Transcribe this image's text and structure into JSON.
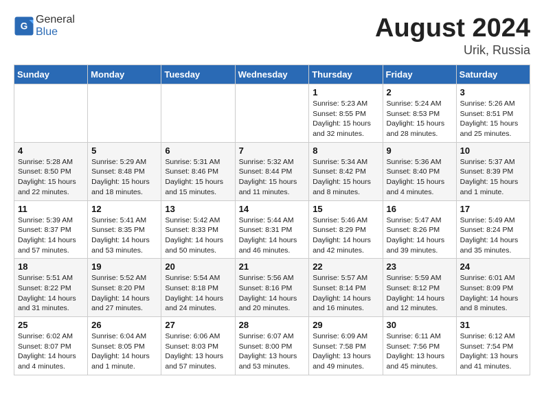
{
  "header": {
    "logo_general": "General",
    "logo_blue": "Blue",
    "month_year": "August 2024",
    "location": "Urik, Russia"
  },
  "weekdays": [
    "Sunday",
    "Monday",
    "Tuesday",
    "Wednesday",
    "Thursday",
    "Friday",
    "Saturday"
  ],
  "weeks": [
    [
      {
        "day": "",
        "details": ""
      },
      {
        "day": "",
        "details": ""
      },
      {
        "day": "",
        "details": ""
      },
      {
        "day": "",
        "details": ""
      },
      {
        "day": "1",
        "details": "Sunrise: 5:23 AM\nSunset: 8:55 PM\nDaylight: 15 hours\nand 32 minutes."
      },
      {
        "day": "2",
        "details": "Sunrise: 5:24 AM\nSunset: 8:53 PM\nDaylight: 15 hours\nand 28 minutes."
      },
      {
        "day": "3",
        "details": "Sunrise: 5:26 AM\nSunset: 8:51 PM\nDaylight: 15 hours\nand 25 minutes."
      }
    ],
    [
      {
        "day": "4",
        "details": "Sunrise: 5:28 AM\nSunset: 8:50 PM\nDaylight: 15 hours\nand 22 minutes."
      },
      {
        "day": "5",
        "details": "Sunrise: 5:29 AM\nSunset: 8:48 PM\nDaylight: 15 hours\nand 18 minutes."
      },
      {
        "day": "6",
        "details": "Sunrise: 5:31 AM\nSunset: 8:46 PM\nDaylight: 15 hours\nand 15 minutes."
      },
      {
        "day": "7",
        "details": "Sunrise: 5:32 AM\nSunset: 8:44 PM\nDaylight: 15 hours\nand 11 minutes."
      },
      {
        "day": "8",
        "details": "Sunrise: 5:34 AM\nSunset: 8:42 PM\nDaylight: 15 hours\nand 8 minutes."
      },
      {
        "day": "9",
        "details": "Sunrise: 5:36 AM\nSunset: 8:40 PM\nDaylight: 15 hours\nand 4 minutes."
      },
      {
        "day": "10",
        "details": "Sunrise: 5:37 AM\nSunset: 8:39 PM\nDaylight: 15 hours\nand 1 minute."
      }
    ],
    [
      {
        "day": "11",
        "details": "Sunrise: 5:39 AM\nSunset: 8:37 PM\nDaylight: 14 hours\nand 57 minutes."
      },
      {
        "day": "12",
        "details": "Sunrise: 5:41 AM\nSunset: 8:35 PM\nDaylight: 14 hours\nand 53 minutes."
      },
      {
        "day": "13",
        "details": "Sunrise: 5:42 AM\nSunset: 8:33 PM\nDaylight: 14 hours\nand 50 minutes."
      },
      {
        "day": "14",
        "details": "Sunrise: 5:44 AM\nSunset: 8:31 PM\nDaylight: 14 hours\nand 46 minutes."
      },
      {
        "day": "15",
        "details": "Sunrise: 5:46 AM\nSunset: 8:29 PM\nDaylight: 14 hours\nand 42 minutes."
      },
      {
        "day": "16",
        "details": "Sunrise: 5:47 AM\nSunset: 8:26 PM\nDaylight: 14 hours\nand 39 minutes."
      },
      {
        "day": "17",
        "details": "Sunrise: 5:49 AM\nSunset: 8:24 PM\nDaylight: 14 hours\nand 35 minutes."
      }
    ],
    [
      {
        "day": "18",
        "details": "Sunrise: 5:51 AM\nSunset: 8:22 PM\nDaylight: 14 hours\nand 31 minutes."
      },
      {
        "day": "19",
        "details": "Sunrise: 5:52 AM\nSunset: 8:20 PM\nDaylight: 14 hours\nand 27 minutes."
      },
      {
        "day": "20",
        "details": "Sunrise: 5:54 AM\nSunset: 8:18 PM\nDaylight: 14 hours\nand 24 minutes."
      },
      {
        "day": "21",
        "details": "Sunrise: 5:56 AM\nSunset: 8:16 PM\nDaylight: 14 hours\nand 20 minutes."
      },
      {
        "day": "22",
        "details": "Sunrise: 5:57 AM\nSunset: 8:14 PM\nDaylight: 14 hours\nand 16 minutes."
      },
      {
        "day": "23",
        "details": "Sunrise: 5:59 AM\nSunset: 8:12 PM\nDaylight: 14 hours\nand 12 minutes."
      },
      {
        "day": "24",
        "details": "Sunrise: 6:01 AM\nSunset: 8:09 PM\nDaylight: 14 hours\nand 8 minutes."
      }
    ],
    [
      {
        "day": "25",
        "details": "Sunrise: 6:02 AM\nSunset: 8:07 PM\nDaylight: 14 hours\nand 4 minutes."
      },
      {
        "day": "26",
        "details": "Sunrise: 6:04 AM\nSunset: 8:05 PM\nDaylight: 14 hours\nand 1 minute."
      },
      {
        "day": "27",
        "details": "Sunrise: 6:06 AM\nSunset: 8:03 PM\nDaylight: 13 hours\nand 57 minutes."
      },
      {
        "day": "28",
        "details": "Sunrise: 6:07 AM\nSunset: 8:00 PM\nDaylight: 13 hours\nand 53 minutes."
      },
      {
        "day": "29",
        "details": "Sunrise: 6:09 AM\nSunset: 7:58 PM\nDaylight: 13 hours\nand 49 minutes."
      },
      {
        "day": "30",
        "details": "Sunrise: 6:11 AM\nSunset: 7:56 PM\nDaylight: 13 hours\nand 45 minutes."
      },
      {
        "day": "31",
        "details": "Sunrise: 6:12 AM\nSunset: 7:54 PM\nDaylight: 13 hours\nand 41 minutes."
      }
    ]
  ]
}
